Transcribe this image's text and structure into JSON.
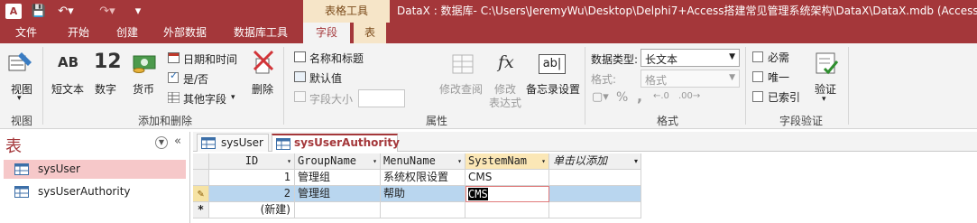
{
  "title_bar": {
    "contextual_tab": "表格工具",
    "window_title": "DataX : 数据库- C:\\Users\\JeremyWu\\Desktop\\Delphi7+Access搭建常见管理系统架构\\DataX\\DataX.mdb (Access 2"
  },
  "ribbon_tabs": [
    "文件",
    "开始",
    "创建",
    "外部数据",
    "数据库工具",
    "字段",
    "表"
  ],
  "ribbon": {
    "view": {
      "label": "视图",
      "group": "视图"
    },
    "add_delete": {
      "group": "添加和删除",
      "short_text": "短文本",
      "number": "数字",
      "number_icon": "12",
      "short_text_icon": "AB",
      "currency": "货币",
      "datetime": "日期和时间",
      "yesno": "是/否",
      "more_fields": "其他字段",
      "delete": "删除"
    },
    "properties": {
      "group": "属性",
      "name_caption": "名称和标题",
      "default_value": "默认值",
      "field_size": "字段大小",
      "modify_lookup": "修改查阅",
      "modify_expr_1": "修改",
      "modify_expr_2": "表达式",
      "memo_settings": "备忘录设置",
      "fx_icon": "fx",
      "ab_icon": "ab|"
    },
    "formatting": {
      "group": "格式",
      "data_type_label": "数据类型:",
      "data_type_value": "长文本",
      "format_label": "格式:",
      "format_value": "格式",
      "percent": "%",
      "comma": ","
    },
    "validation": {
      "group": "字段验证",
      "required": "必需",
      "unique": "唯一",
      "indexed": "已索引",
      "validation": "验证"
    }
  },
  "nav_pane": {
    "title": "表",
    "items": [
      "sysUser",
      "sysUserAuthority"
    ]
  },
  "doc_tabs": [
    "sysUser",
    "sysUserAuthority"
  ],
  "grid": {
    "columns": [
      "ID",
      "GroupName",
      "MenuName",
      "SystemNam",
      "单击以添加"
    ],
    "rows": [
      {
        "id": "1",
        "group": "管理组",
        "menu": "系统权限设置",
        "system": "CMS"
      },
      {
        "id": "2",
        "group": "管理组",
        "menu": "帮助",
        "system": "CMS"
      }
    ],
    "new_row": "(新建)"
  }
}
